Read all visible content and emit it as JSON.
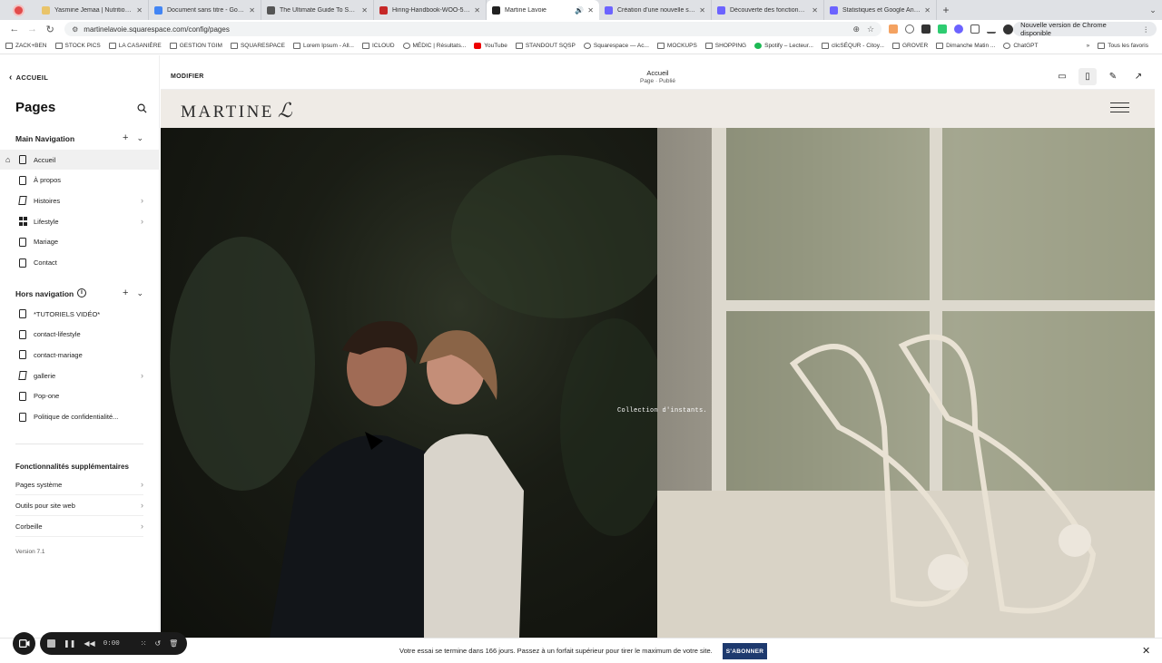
{
  "browser": {
    "tabs": [
      {
        "title": "Yasmine Jemaa | Nutritionnis",
        "color": "#e9c46a"
      },
      {
        "title": "Document sans titre - Google",
        "color": "#4285f4"
      },
      {
        "title": "The Ultimate Guide To Small",
        "color": "#555555"
      },
      {
        "title": "Hiring-Handbook-WOO-5-23",
        "color": "#c62828"
      },
      {
        "title": "Martine Lavoie",
        "color": "#222222",
        "active": true
      },
      {
        "title": "Création d'une nouvelle séan",
        "color": "#6c63ff"
      },
      {
        "title": "Découverte des fonctionnalit",
        "color": "#6c63ff"
      },
      {
        "title": "Statistiques et Google Analyt",
        "color": "#6c63ff"
      }
    ],
    "new_tab": "+",
    "url": "martinelavoie.squarespace.com/config/pages",
    "update_label": "Nouvelle version de Chrome disponible",
    "bookmarks": [
      "ZACK+BEN",
      "STOCK PICS",
      "LA CASANIÈRE",
      "GESTION TGIM",
      "SQUARESPACE",
      "Lorem Ipsum - All...",
      "ICLOUD",
      "MÉDIC | Résultats...",
      "YouTube",
      "STANDOUT SQSP",
      "Squarespace — Ac...",
      "MOCKUPS",
      "SHOPPING",
      "Spotify – Lecteur...",
      "clicSÉQUR - Citoy...",
      "GROVER",
      "Dimanche Matin ...",
      "ChatGPT"
    ],
    "bookmarks_more": "»",
    "all_bookmarks": "Tous les favoris"
  },
  "sidebar": {
    "back_label": "ACCUEIL",
    "title": "Pages",
    "main_nav": {
      "label": "Main Navigation",
      "items": [
        {
          "label": "Accueil",
          "icon": "page",
          "home": true,
          "active": true
        },
        {
          "label": "À propos",
          "icon": "page"
        },
        {
          "label": "Histoires",
          "icon": "blog",
          "chevron": true
        },
        {
          "label": "Lifestyle",
          "icon": "grid",
          "chevron": true
        },
        {
          "label": "Mariage",
          "icon": "page"
        },
        {
          "label": "Contact",
          "icon": "page"
        }
      ]
    },
    "hors_nav": {
      "label": "Hors navigation",
      "items": [
        {
          "label": "*TUTORIELS VIDÉO*",
          "icon": "page"
        },
        {
          "label": "contact-lifestyle",
          "icon": "page"
        },
        {
          "label": "contact-mariage",
          "icon": "page"
        },
        {
          "label": "gallerie",
          "icon": "blog",
          "chevron": true
        },
        {
          "label": "Pop-one",
          "icon": "page"
        },
        {
          "label": "Politique de confidentialité...",
          "icon": "page"
        }
      ]
    },
    "extra": {
      "label": "Fonctionnalités supplémentaires",
      "items": [
        "Pages système",
        "Outils pour site web",
        "Corbeille"
      ]
    },
    "version": "Version 7.1"
  },
  "editor": {
    "modify_label": "MODIFIER",
    "page_title": "Accueil",
    "page_status": "Page · Publié"
  },
  "site": {
    "logo_text": "MARTINE",
    "logo_mono": "ℒ",
    "caption": "Collection d'instants."
  },
  "trial": {
    "message": "Votre essai se termine dans 166 jours. Passez à un forfait supérieur pour tirer le maximum de votre site.",
    "cta": "S'ABONNER",
    "close": "✕"
  },
  "recorder": {
    "time": "0:00"
  }
}
